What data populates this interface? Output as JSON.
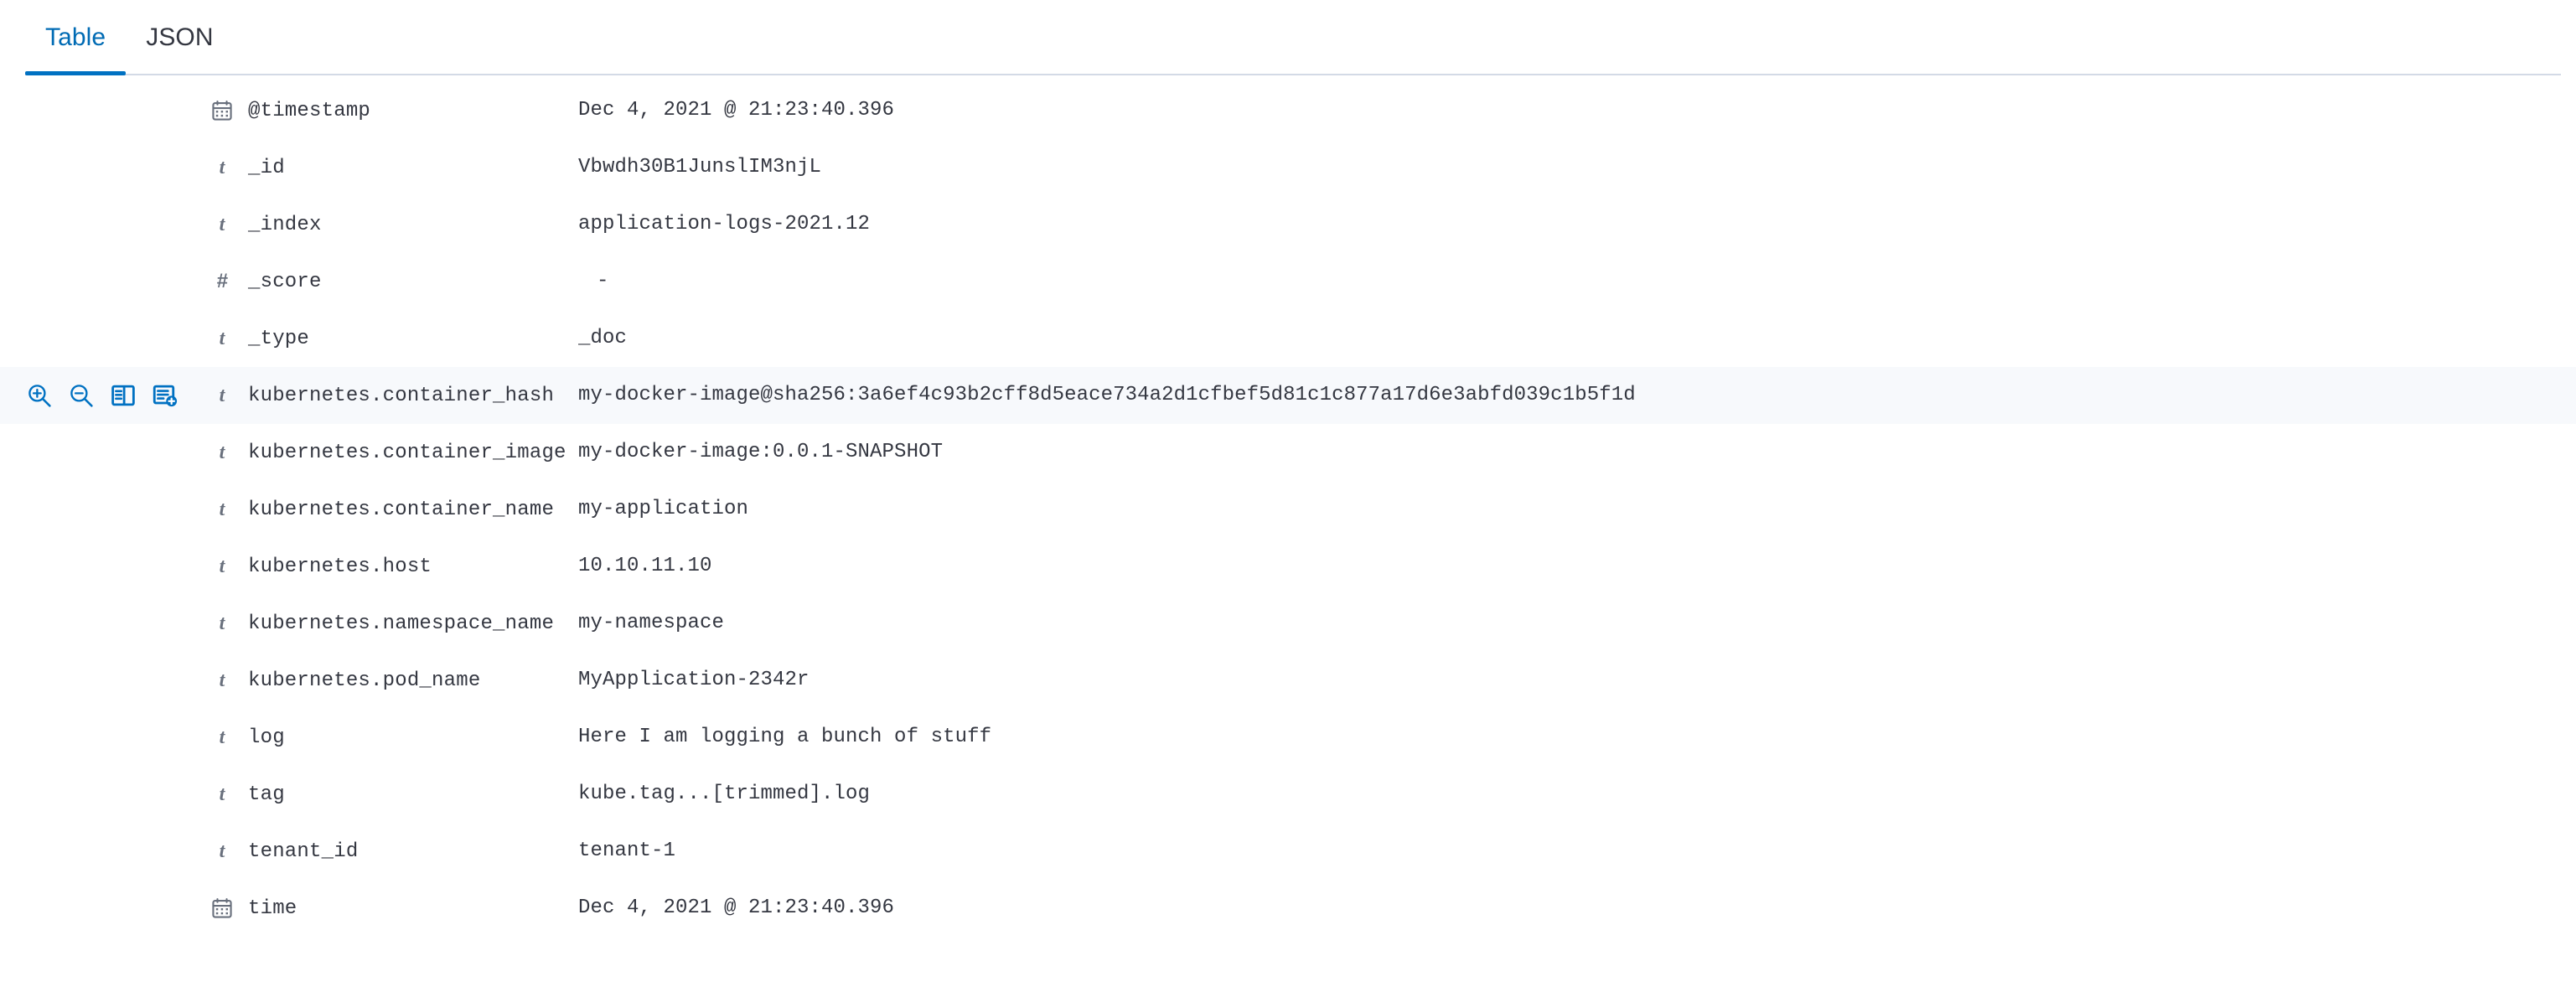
{
  "tabs": [
    {
      "id": "table",
      "label": "Table",
      "active": true
    },
    {
      "id": "json",
      "label": "JSON",
      "active": false
    }
  ],
  "colors": {
    "accent": "#006BB4",
    "underline": "#0071C2",
    "icon_blue": "#0071C2",
    "row_highlight": "#F7F9FC",
    "text": "#343741",
    "muted": "#69707D",
    "border": "#D3DAE6"
  },
  "row_actions": [
    {
      "name": "filter-for-value",
      "icon": "magnify-plus-icon"
    },
    {
      "name": "filter-out-value",
      "icon": "magnify-minus-icon"
    },
    {
      "name": "toggle-column-in-table",
      "icon": "table-column-icon"
    },
    {
      "name": "filter-for-field-present",
      "icon": "list-add-icon"
    }
  ],
  "fields": [
    {
      "type": "date",
      "icon": "calendar-icon",
      "name": "@timestamp",
      "value": "Dec 4, 2021 @ 21:23:40.396",
      "highlighted": false
    },
    {
      "type": "string",
      "icon": "string-icon",
      "name": "_id",
      "value": "Vbwdh30B1JunslIM3njL",
      "highlighted": false
    },
    {
      "type": "string",
      "icon": "string-icon",
      "name": "_index",
      "value": "application-logs-2021.12",
      "highlighted": false
    },
    {
      "type": "number",
      "icon": "number-icon",
      "name": "_score",
      "value": "-",
      "highlighted": false
    },
    {
      "type": "string",
      "icon": "string-icon",
      "name": "_type",
      "value": "_doc",
      "highlighted": false
    },
    {
      "type": "string",
      "icon": "string-icon",
      "name": "kubernetes.container_hash",
      "value": "my-docker-image@sha256:3a6ef4c93b2cff8d5eace734a2d1cfbef5d81c1c877a17d6e3abfd039c1b5f1d",
      "highlighted": true
    },
    {
      "type": "string",
      "icon": "string-icon",
      "name": "kubernetes.container_image",
      "value": "my-docker-image:0.0.1-SNAPSHOT",
      "highlighted": false
    },
    {
      "type": "string",
      "icon": "string-icon",
      "name": "kubernetes.container_name",
      "value": "my-application",
      "highlighted": false
    },
    {
      "type": "string",
      "icon": "string-icon",
      "name": "kubernetes.host",
      "value": "10.10.11.10",
      "highlighted": false
    },
    {
      "type": "string",
      "icon": "string-icon",
      "name": "kubernetes.namespace_name",
      "value": "my-namespace",
      "highlighted": false
    },
    {
      "type": "string",
      "icon": "string-icon",
      "name": "kubernetes.pod_name",
      "value": "MyApplication-2342r",
      "highlighted": false
    },
    {
      "type": "string",
      "icon": "string-icon",
      "name": "log",
      "value": "Here I am logging a bunch of stuff",
      "highlighted": false
    },
    {
      "type": "string",
      "icon": "string-icon",
      "name": "tag",
      "value": "kube.tag...[trimmed].log",
      "highlighted": false
    },
    {
      "type": "string",
      "icon": "string-icon",
      "name": "tenant_id",
      "value": "tenant-1",
      "highlighted": false
    },
    {
      "type": "date",
      "icon": "calendar-icon",
      "name": "time",
      "value": "Dec 4, 2021 @ 21:23:40.396",
      "highlighted": false
    }
  ],
  "type_glyphs": {
    "string": "t",
    "number": "#"
  }
}
